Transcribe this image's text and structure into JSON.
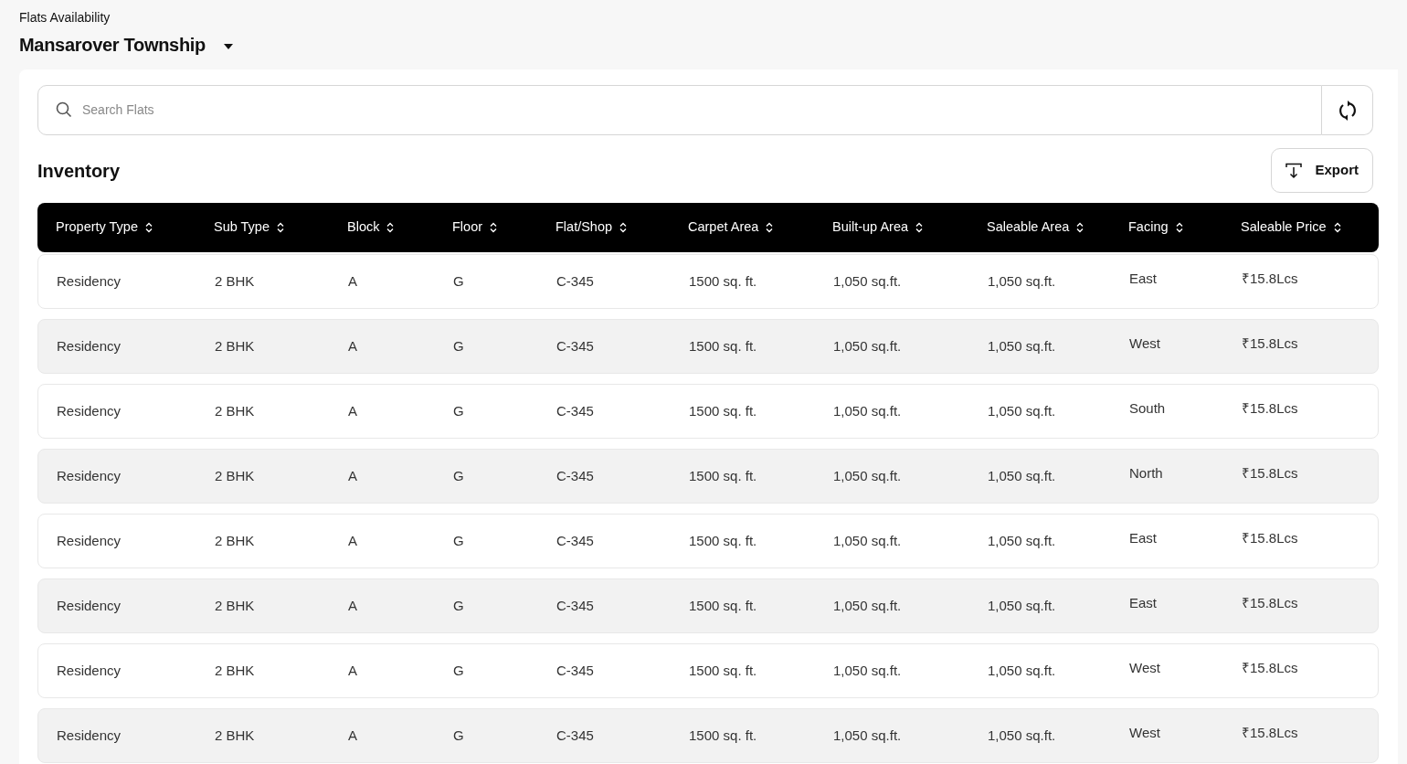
{
  "header": {
    "subtitle": "Flats Availability",
    "project": "Mansarover Township"
  },
  "search": {
    "placeholder": "Search Flats"
  },
  "section_title": "Inventory",
  "export_button": "Export",
  "table": {
    "columns": [
      "Property Type",
      "Sub Type",
      "Block",
      "Floor",
      "Flat/Shop",
      "Carpet Area",
      "Built-up Area",
      "Saleable Area",
      "Facing",
      "Saleable Price"
    ],
    "rows": [
      [
        "Residency",
        "2 BHK",
        "A",
        "G",
        "C-345",
        "1500 sq. ft.",
        "1,050 sq.ft.",
        "1,050 sq.ft.",
        "East",
        "₹15.8Lcs"
      ],
      [
        "Residency",
        "2 BHK",
        "A",
        "G",
        "C-345",
        "1500 sq. ft.",
        "1,050 sq.ft.",
        "1,050 sq.ft.",
        "West",
        "₹15.8Lcs"
      ],
      [
        "Residency",
        "2 BHK",
        "A",
        "G",
        "C-345",
        "1500 sq. ft.",
        "1,050 sq.ft.",
        "1,050 sq.ft.",
        "South",
        "₹15.8Lcs"
      ],
      [
        "Residency",
        "2 BHK",
        "A",
        "G",
        "C-345",
        "1500 sq. ft.",
        "1,050 sq.ft.",
        "1,050 sq.ft.",
        "North",
        "₹15.8Lcs"
      ],
      [
        "Residency",
        "2 BHK",
        "A",
        "G",
        "C-345",
        "1500 sq. ft.",
        "1,050 sq.ft.",
        "1,050 sq.ft.",
        "East",
        "₹15.8Lcs"
      ],
      [
        "Residency",
        "2 BHK",
        "A",
        "G",
        "C-345",
        "1500 sq. ft.",
        "1,050 sq.ft.",
        "1,050 sq.ft.",
        "East",
        "₹15.8Lcs"
      ],
      [
        "Residency",
        "2 BHK",
        "A",
        "G",
        "C-345",
        "1500 sq. ft.",
        "1,050 sq.ft.",
        "1,050 sq.ft.",
        "West",
        "₹15.8Lcs"
      ],
      [
        "Residency",
        "2 BHK",
        "A",
        "G",
        "C-345",
        "1500 sq. ft.",
        "1,050 sq.ft.",
        "1,050 sq.ft.",
        "West",
        "₹15.8Lcs"
      ]
    ]
  }
}
